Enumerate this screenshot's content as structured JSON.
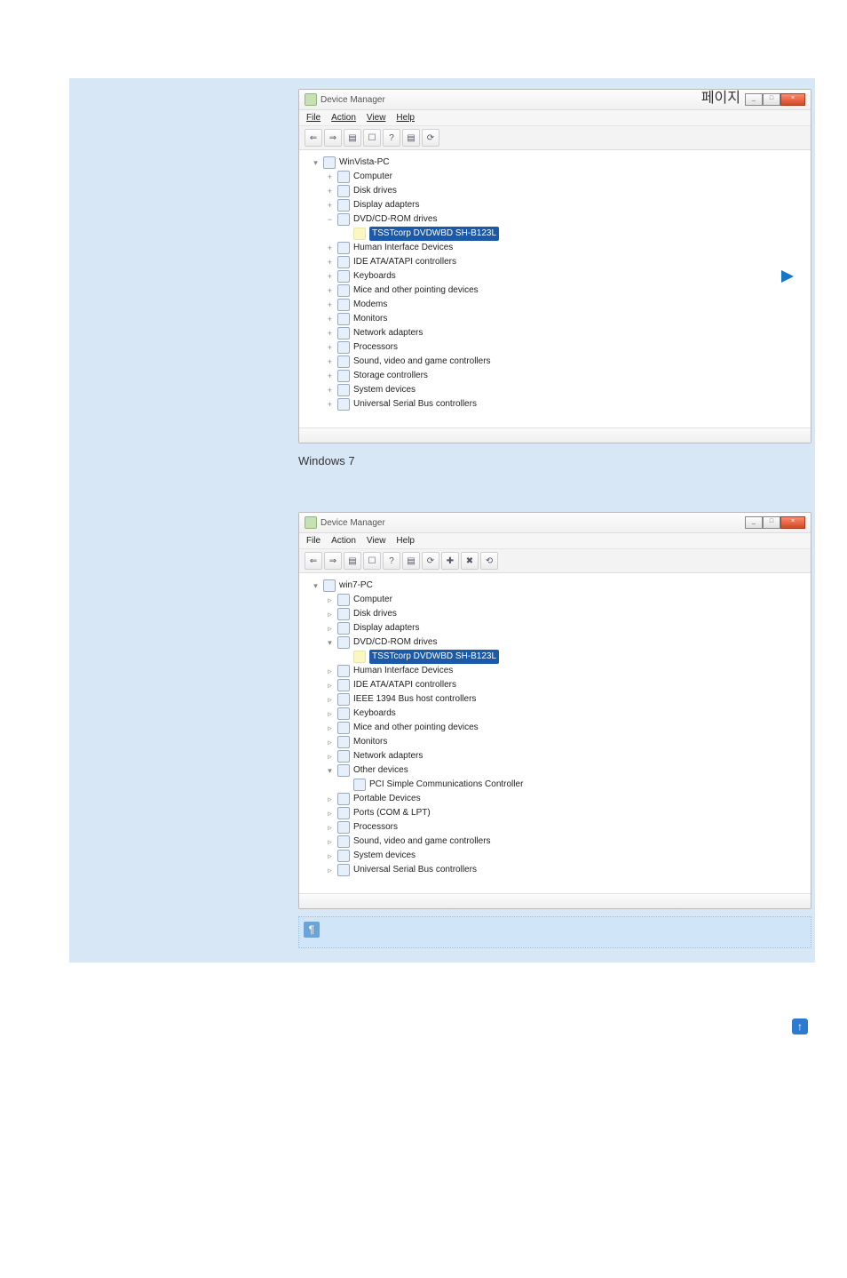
{
  "page_label": "페이지",
  "pointer_color": "#1476c6",
  "top_link_icon": "↑",
  "note_icon": "¶",
  "screenshot1": {
    "title": "Device Manager",
    "menus": [
      "File",
      "Action",
      "View",
      "Help"
    ],
    "tool_icons": [
      "⇐",
      "⇒",
      "▤",
      "☐",
      "?",
      "▤",
      "⟳"
    ],
    "win_controls": {
      "min": "_",
      "max": "□",
      "close": "×"
    },
    "tree": {
      "root": "WinVista-PC",
      "nodes": [
        {
          "label": "Computer",
          "tw": "+"
        },
        {
          "label": "Disk drives",
          "tw": "+"
        },
        {
          "label": "Display adapters",
          "tw": "+"
        },
        {
          "label": "DVD/CD-ROM drives",
          "tw": "−",
          "children": [
            {
              "label": "TSSTcorp DVDWBD SH-B123L",
              "selected": true
            }
          ]
        },
        {
          "label": "Human Interface Devices",
          "tw": "+"
        },
        {
          "label": "IDE ATA/ATAPI controllers",
          "tw": "+"
        },
        {
          "label": "Keyboards",
          "tw": "+"
        },
        {
          "label": "Mice and other pointing devices",
          "tw": "+"
        },
        {
          "label": "Modems",
          "tw": "+"
        },
        {
          "label": "Monitors",
          "tw": "+"
        },
        {
          "label": "Network adapters",
          "tw": "+"
        },
        {
          "label": "Processors",
          "tw": "+"
        },
        {
          "label": "Sound, video and game controllers",
          "tw": "+"
        },
        {
          "label": "Storage controllers",
          "tw": "+"
        },
        {
          "label": "System devices",
          "tw": "+"
        },
        {
          "label": "Universal Serial Bus controllers",
          "tw": "+"
        }
      ]
    }
  },
  "caption1": "Windows 7",
  "screenshot2": {
    "title": "Device Manager",
    "menus": [
      "File",
      "Action",
      "View",
      "Help"
    ],
    "tool_icons": [
      "⇐",
      "⇒",
      "▤",
      "☐",
      "?",
      "▤",
      "⟳",
      "✚",
      "✖",
      "⟲"
    ],
    "win_controls": {
      "min": "_",
      "max": "□",
      "close": "×"
    },
    "tree": {
      "root": "win7-PC",
      "nodes": [
        {
          "label": "Computer",
          "tw": "▹"
        },
        {
          "label": "Disk drives",
          "tw": "▹"
        },
        {
          "label": "Display adapters",
          "tw": "▹"
        },
        {
          "label": "DVD/CD-ROM drives",
          "tw": "▾",
          "children": [
            {
              "label": "TSSTcorp DVDWBD SH-B123L",
              "selected": true
            }
          ]
        },
        {
          "label": "Human Interface Devices",
          "tw": "▹"
        },
        {
          "label": "IDE ATA/ATAPI controllers",
          "tw": "▹"
        },
        {
          "label": "IEEE 1394 Bus host controllers",
          "tw": "▹"
        },
        {
          "label": "Keyboards",
          "tw": "▹"
        },
        {
          "label": "Mice and other pointing devices",
          "tw": "▹"
        },
        {
          "label": "Monitors",
          "tw": "▹"
        },
        {
          "label": "Network adapters",
          "tw": "▹"
        },
        {
          "label": "Other devices",
          "tw": "▾",
          "children": [
            {
              "label": "PCI Simple Communications Controller"
            }
          ]
        },
        {
          "label": "Portable Devices",
          "tw": "▹"
        },
        {
          "label": "Ports (COM & LPT)",
          "tw": "▹"
        },
        {
          "label": "Processors",
          "tw": "▹"
        },
        {
          "label": "Sound, video and game controllers",
          "tw": "▹"
        },
        {
          "label": "System devices",
          "tw": "▹"
        },
        {
          "label": "Universal Serial Bus controllers",
          "tw": "▹"
        }
      ]
    }
  }
}
